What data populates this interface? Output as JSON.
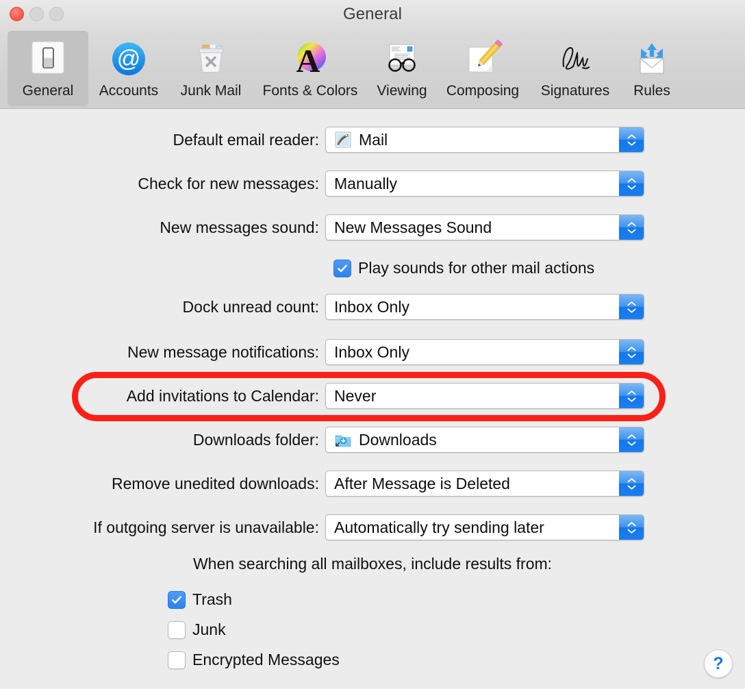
{
  "window": {
    "title": "General",
    "traffic_lights": [
      "close",
      "minimize",
      "zoom"
    ]
  },
  "toolbar": {
    "tabs": [
      {
        "label": "General",
        "icon": "general-switch-icon",
        "selected": true
      },
      {
        "label": "Accounts",
        "icon": "at-sign-icon",
        "selected": false
      },
      {
        "label": "Junk Mail",
        "icon": "trash-can-icon",
        "selected": false
      },
      {
        "label": "Fonts & Colors",
        "icon": "font-color-a-icon",
        "selected": false
      },
      {
        "label": "Viewing",
        "icon": "eyeglasses-mail-icon",
        "selected": false
      },
      {
        "label": "Composing",
        "icon": "pencil-paper-icon",
        "selected": false
      },
      {
        "label": "Signatures",
        "icon": "signature-icon",
        "selected": false
      },
      {
        "label": "Rules",
        "icon": "rules-envelope-icon",
        "selected": false
      }
    ]
  },
  "main": {
    "rows": [
      {
        "label": "Default email reader:",
        "value": "Mail",
        "icon": "mail-app-icon"
      },
      {
        "label": "Check for new messages:",
        "value": "Manually",
        "icon": null
      },
      {
        "label": "New messages sound:",
        "value": "New Messages Sound",
        "icon": null
      },
      {
        "label": "Dock unread count:",
        "value": "Inbox Only",
        "icon": null
      },
      {
        "label": "New message notifications:",
        "value": "Inbox Only",
        "icon": null
      },
      {
        "label": "Add invitations to Calendar:",
        "value": "Never",
        "icon": null
      },
      {
        "label": "Downloads folder:",
        "value": "Downloads",
        "icon": "downloads-folder-icon"
      },
      {
        "label": "Remove unedited downloads:",
        "value": "After Message is Deleted",
        "icon": null
      },
      {
        "label": "If outgoing server is unavailable:",
        "value": "Automatically try sending later",
        "icon": null
      }
    ],
    "play_sounds_checkbox": {
      "label": "Play sounds for other mail actions",
      "checked": true
    },
    "search_heading": "When searching all mailboxes, include results from:",
    "search_checkboxes": [
      {
        "label": "Trash",
        "checked": true
      },
      {
        "label": "Junk",
        "checked": false
      },
      {
        "label": "Encrypted Messages",
        "checked": false
      }
    ]
  },
  "help_button": {
    "label": "?"
  },
  "annotation": {
    "target_label": "Add invitations to Calendar:",
    "color": "#fb2016",
    "shape": "rounded-rectangle-highlight"
  },
  "colors": {
    "accent_blue": "#1478ec",
    "window_bg": "#ececec",
    "toolbar_bg": "#d4d4d4",
    "titlebar_bg": "#e2e2e2",
    "selected_tab_bg": "#c2c2c2",
    "annotation_red": "#fb2016"
  }
}
